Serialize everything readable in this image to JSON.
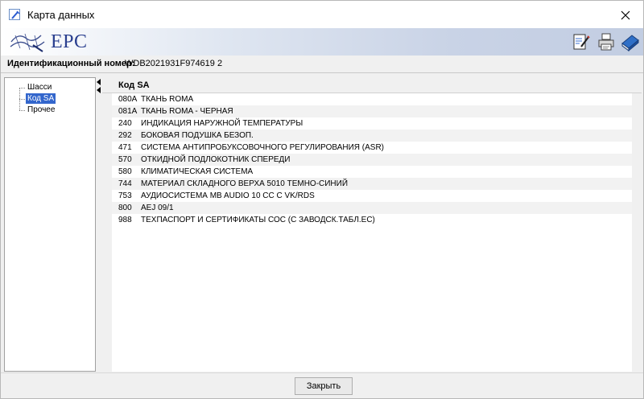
{
  "window": {
    "title": "Карта данных"
  },
  "banner": {
    "logo_text": "EPC"
  },
  "id_bar": {
    "label": "Идентификационный номер:",
    "value": "WDB2021931F974619 2"
  },
  "tree": {
    "items": [
      {
        "label": "Шасси",
        "selected": false
      },
      {
        "label": "Код SA",
        "selected": true
      },
      {
        "label": "Прочее",
        "selected": false
      }
    ]
  },
  "table": {
    "header": "Код SA",
    "rows": [
      {
        "code": "080A",
        "desc": "ТКАНЬ ROMA"
      },
      {
        "code": "081A",
        "desc": "ТКАНЬ ROMA - ЧЕРНАЯ"
      },
      {
        "code": "240",
        "desc": "ИНДИКАЦИЯ НАРУЖНОЙ ТЕМПЕРАТУРЫ"
      },
      {
        "code": "292",
        "desc": "БОКОВАЯ ПОДУШКА БЕЗОП."
      },
      {
        "code": "471",
        "desc": "СИСТЕМА АНТИПРОБУКСОВОЧНОГО РЕГУЛИРОВАНИЯ (ASR)"
      },
      {
        "code": "570",
        "desc": "ОТКИДНОЙ ПОДЛОКОТНИК СПЕРЕДИ"
      },
      {
        "code": "580",
        "desc": "КЛИМАТИЧЕСКАЯ СИСТЕМА"
      },
      {
        "code": "744",
        "desc": "МАТЕРИАЛ СКЛАДНОГО ВЕРХА 5010 ТЕМНО-СИНИЙ"
      },
      {
        "code": "753",
        "desc": "АУДИОСИСТЕМА MB AUDIO 10 CC C VK/RDS"
      },
      {
        "code": "800",
        "desc": "AEJ 09/1"
      },
      {
        "code": "988",
        "desc": "ТЕХПАСПОРТ И СЕРТИФИКАТЫ СОС (С ЗАВОДСК.ТАБЛ.ЕС)"
      }
    ]
  },
  "footer": {
    "close_label": "Закрыть"
  },
  "colors": {
    "selection": "#3366cc",
    "logo": "#2a3f8f"
  },
  "icons": {
    "app": "epc-app-icon",
    "close": "close-icon",
    "edit": "edit-document-icon",
    "print": "printer-icon",
    "book": "book-icon"
  }
}
